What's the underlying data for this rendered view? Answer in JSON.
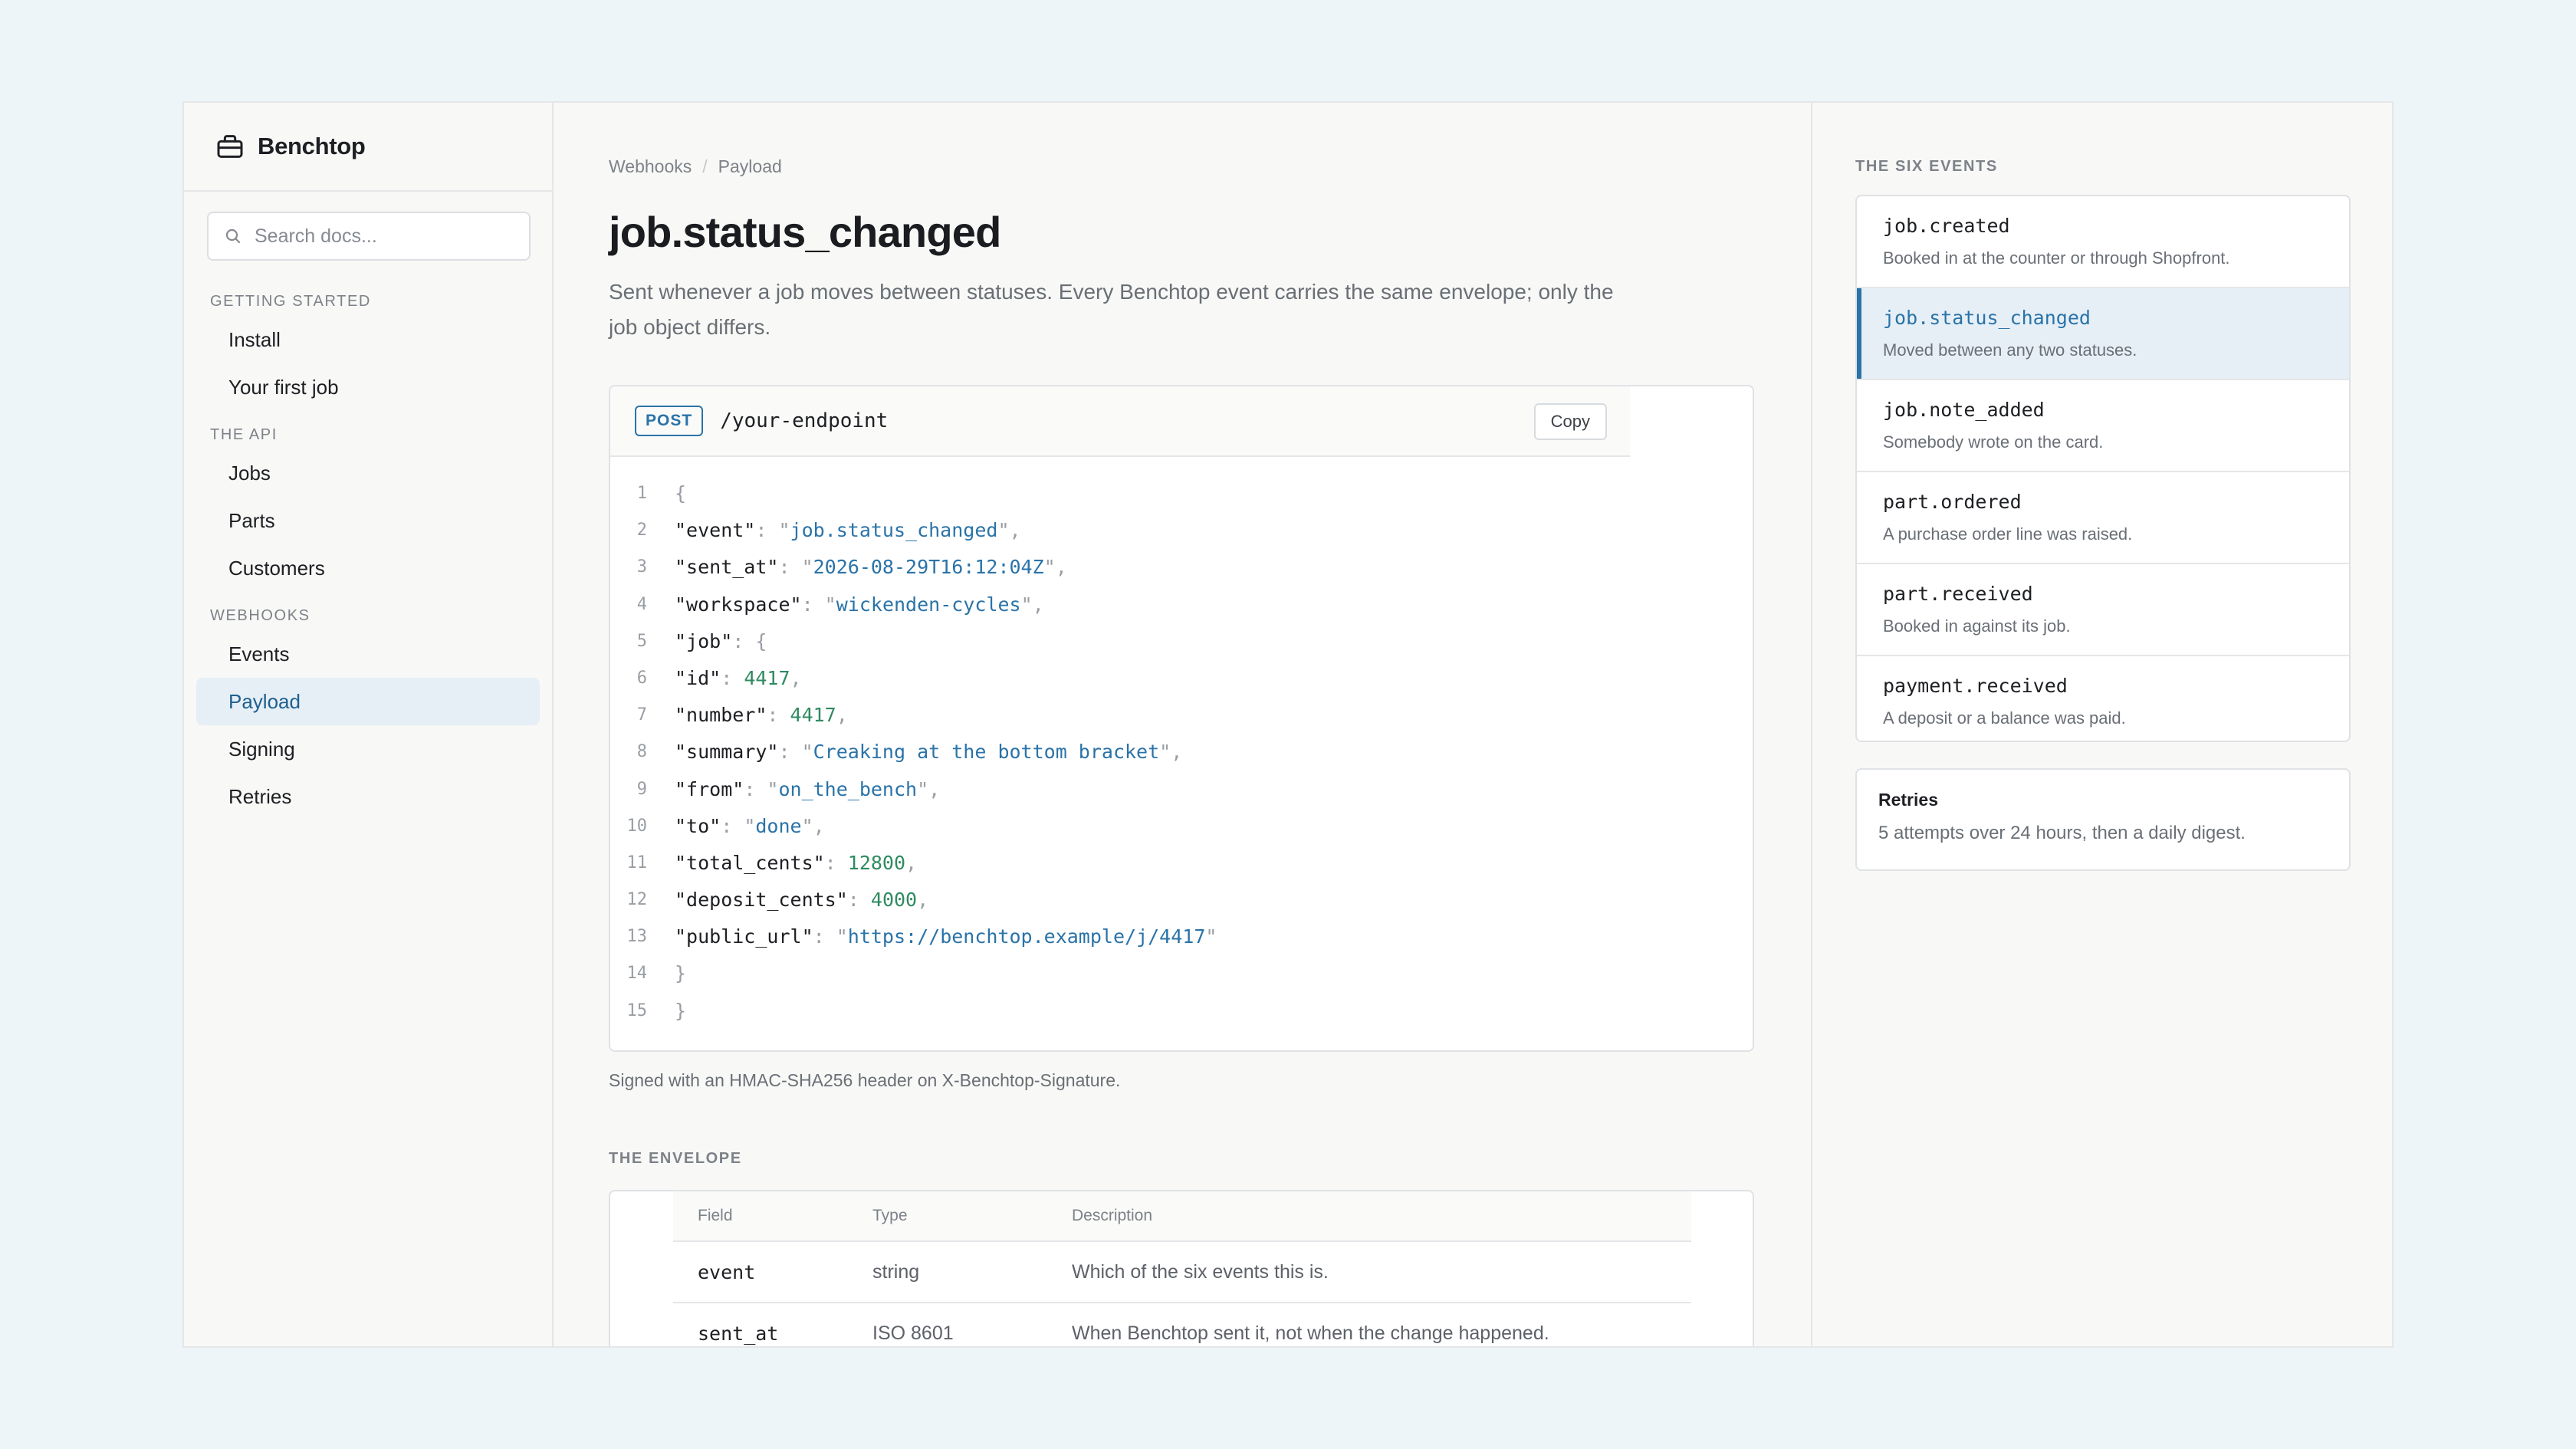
{
  "app": {
    "name": "Benchtop"
  },
  "search": {
    "placeholder": "Search docs..."
  },
  "sidebar": {
    "groups": [
      {
        "title": "GETTING STARTED",
        "items": [
          "Install",
          "Your first job"
        ]
      },
      {
        "title": "THE API",
        "items": [
          "Jobs",
          "Parts",
          "Customers"
        ]
      },
      {
        "title": "WEBHOOKS",
        "items": [
          "Events",
          "Payload",
          "Signing",
          "Retries"
        ]
      }
    ],
    "active_item": "Payload"
  },
  "breadcrumb": [
    "Webhooks",
    "Payload"
  ],
  "page": {
    "title": "job.status_changed",
    "lead": "Sent whenever a job moves between statuses. Every Benchtop event carries the same envelope; only the job object differs."
  },
  "request": {
    "method": "POST",
    "endpoint": "/your-endpoint",
    "copy_label": "Copy"
  },
  "payload": {
    "event": "job.status_changed",
    "sent_at": "2026-08-29T16:12:04Z",
    "workspace": "wickenden-cycles",
    "job": {
      "id": "4417",
      "number": "4417",
      "summary": "Creaking at the bottom bracket",
      "from": "on_the_bench",
      "to": "done",
      "total_cents": "12800",
      "deposit_cents": "4000",
      "public_url": "https://benchtop.example/j/4417"
    }
  },
  "signed_note": "Signed with an HMAC-SHA256 header on X-Benchtop-Signature.",
  "envelope": {
    "title": "THE ENVELOPE",
    "columns": [
      "Field",
      "Type",
      "Description"
    ],
    "rows": [
      {
        "field": "event",
        "type": "string",
        "description": "Which of the six events this is."
      },
      {
        "field": "sent_at",
        "type": "ISO 8601",
        "description": "When Benchtop sent it, not when the change happened."
      }
    ]
  },
  "events_panel": {
    "title": "THE SIX EVENTS",
    "active": "job.status_changed",
    "events": [
      {
        "name": "job.created",
        "description": "Booked in at the counter or through Shopfront."
      },
      {
        "name": "job.status_changed",
        "description": "Moved between any two statuses."
      },
      {
        "name": "job.note_added",
        "description": "Somebody wrote on the card."
      },
      {
        "name": "part.ordered",
        "description": "A purchase order line was raised."
      },
      {
        "name": "part.received",
        "description": "Booked in against its job."
      },
      {
        "name": "payment.received",
        "description": "A deposit or a balance was paid."
      }
    ]
  },
  "retries": {
    "title": "Retries",
    "text": "5 attempts over 24 hours, then a daily digest."
  },
  "colors": {
    "accent": "#2a73a8",
    "number": "#2f8a61",
    "active_bg": "#e6eff6"
  }
}
